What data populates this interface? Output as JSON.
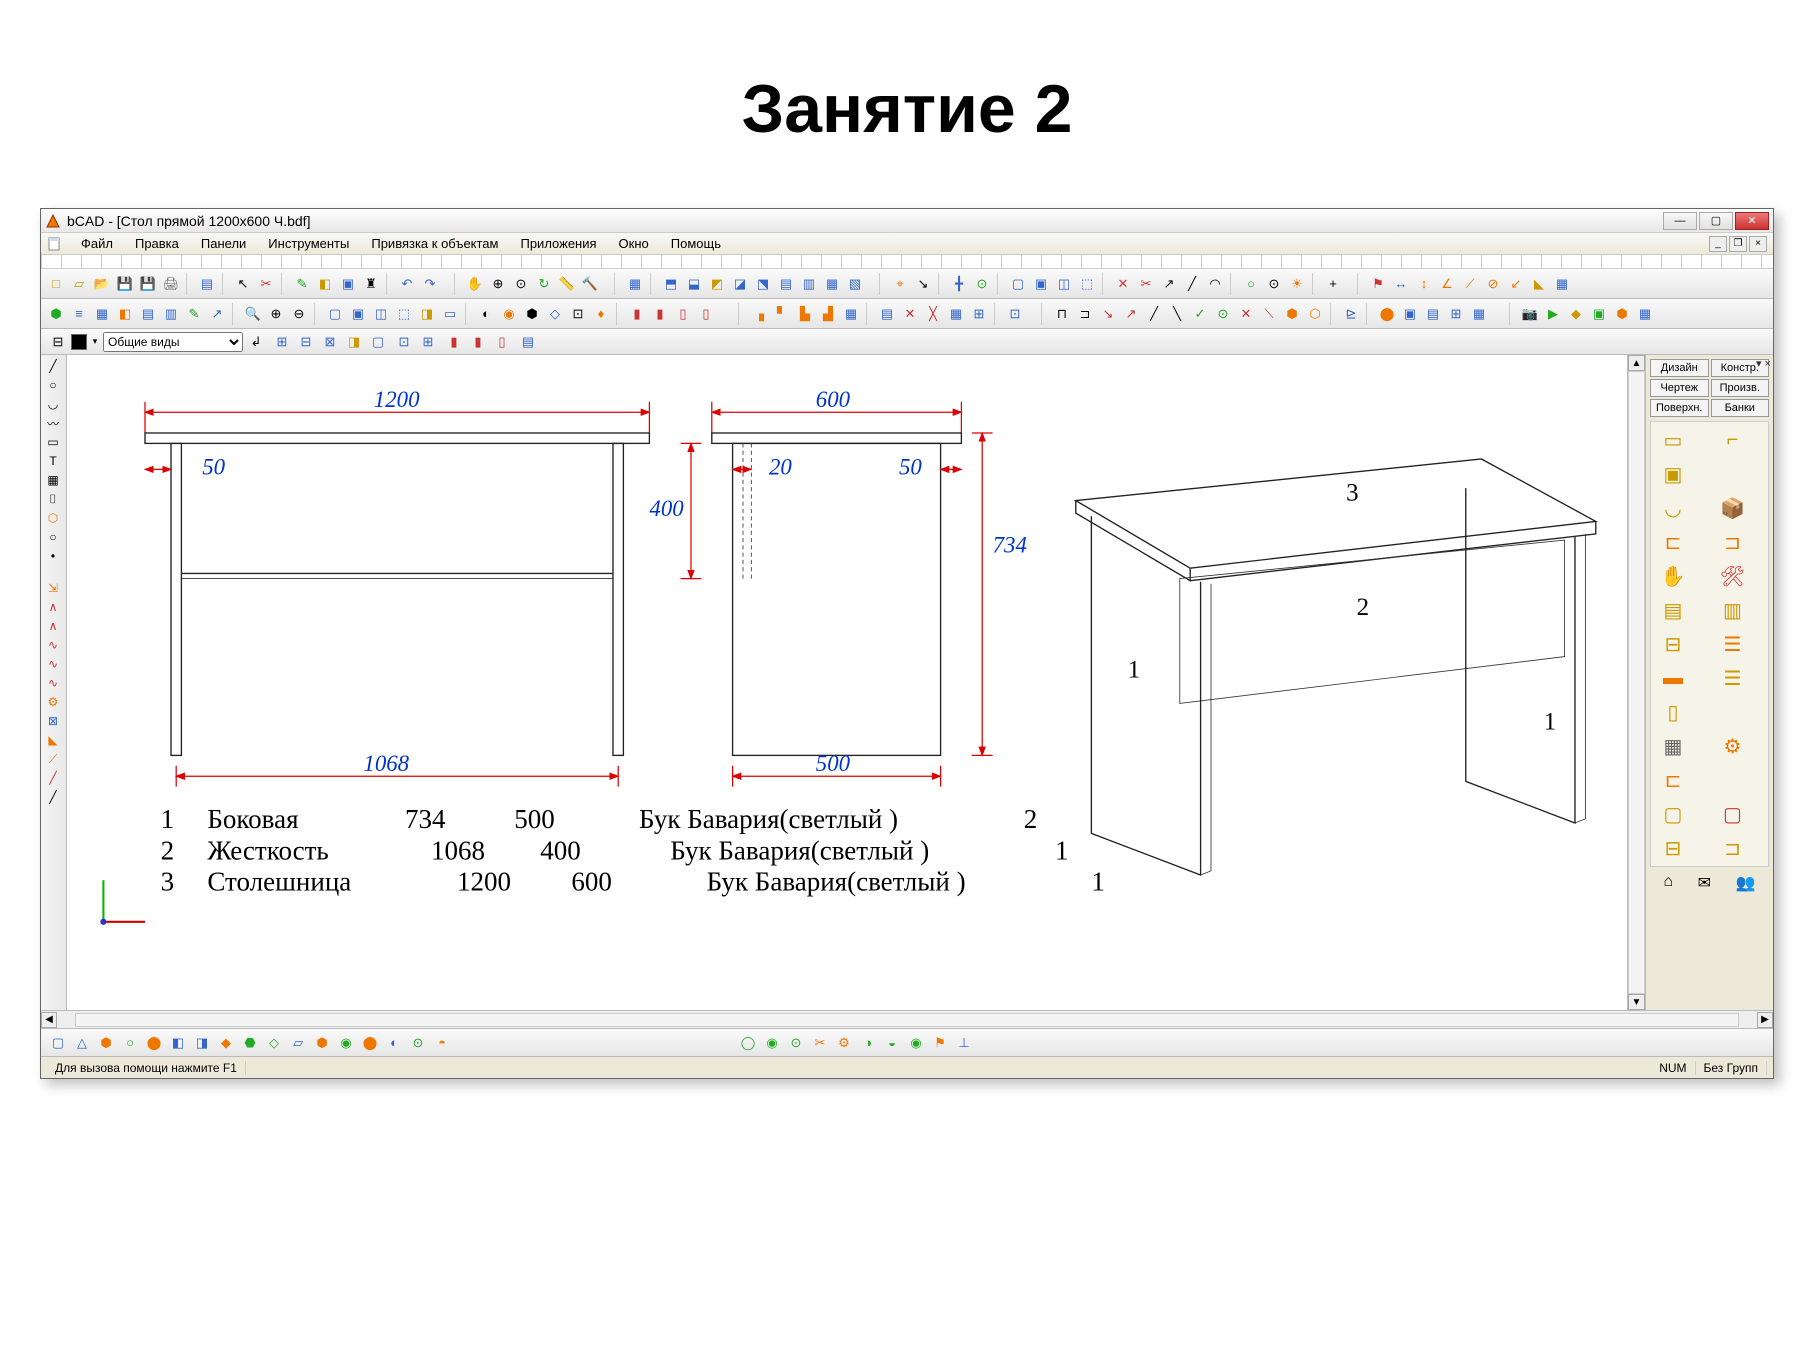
{
  "page": {
    "title": "Занятие 2"
  },
  "window": {
    "title": "bCAD - [Стол прямой 1200x600 Ч.bdf]"
  },
  "menu": {
    "items": [
      "Файл",
      "Правка",
      "Панели",
      "Инструменты",
      "Привязка к объектам",
      "Приложения",
      "Окно",
      "Помощь"
    ]
  },
  "layer": {
    "selected": "Общие виды"
  },
  "right_panel": {
    "tabs": [
      "Дизайн",
      "Констр.",
      "Чертеж",
      "Произв.",
      "Поверхн.",
      "Банки"
    ]
  },
  "status": {
    "help": "Для вызова помощи нажмите F1",
    "num": "NUM",
    "group": "Без Групп"
  },
  "drawing": {
    "dims": {
      "w1": "1200",
      "w2": "600",
      "d50a": "50",
      "d20": "20",
      "d50b": "50",
      "h400": "400",
      "h734": "734",
      "w1068": "1068",
      "w500": "500"
    },
    "labels": {
      "p1": "1",
      "p2": "2",
      "p3": "3"
    },
    "parts": [
      {
        "n": "1",
        "name": "Боковая",
        "a": "734",
        "b": "500",
        "mat": "Бук Бавария(светлый )",
        "qty": "2"
      },
      {
        "n": "2",
        "name": "Жесткость",
        "a": "1068",
        "b": "400",
        "mat": "Бук Бавария(светлый )",
        "qty": "1"
      },
      {
        "n": "3",
        "name": "Столешница",
        "a": "1200",
        "b": "600",
        "mat": "Бук Бавария(светлый )",
        "qty": "1"
      }
    ]
  },
  "icons": {
    "new": "□",
    "open": "📂",
    "save": "💾",
    "print": "🖨",
    "cut": "✂",
    "undo": "↶",
    "redo": "↷",
    "zoom_in": "⊕",
    "zoom_out": "⊖",
    "hand": "✋",
    "measure": "📏",
    "hammer": "🔨",
    "line": "╱",
    "circle": "○",
    "arc": "◡",
    "poly": "〰",
    "rect": "▭",
    "text": "T",
    "hatch": "▦",
    "point": "•",
    "home": "⌂",
    "mail": "✉",
    "group": "👥"
  }
}
